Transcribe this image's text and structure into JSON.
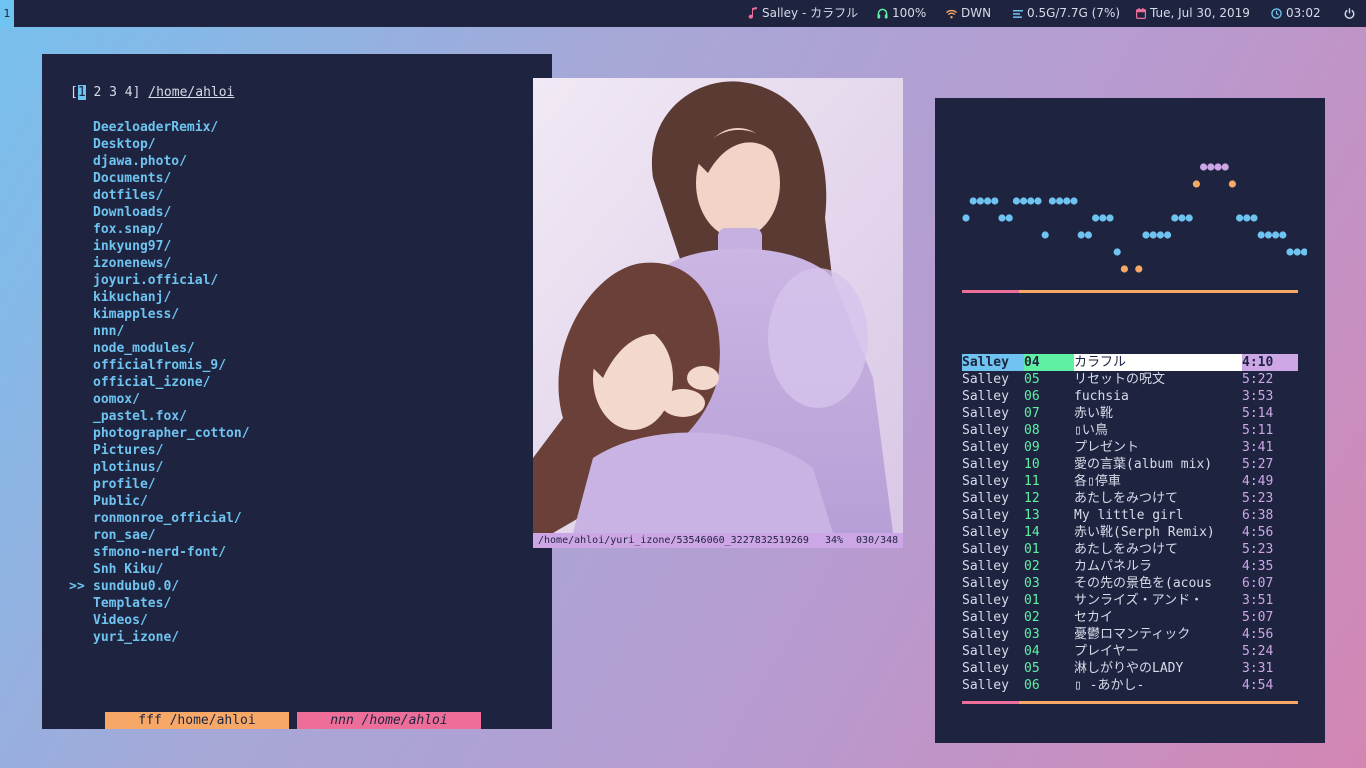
{
  "bar": {
    "workspace": "1",
    "now_playing": "Salley - カラフル",
    "volume": "100%",
    "network": "DWN",
    "memory": "0.5G/7.7G (7%)",
    "date": "Tue, Jul 30, 2019",
    "time": "03:02"
  },
  "file_manager": {
    "tab_open": "[",
    "tabs": [
      "1",
      "2",
      "3",
      "4"
    ],
    "tab_close": "]",
    "path": "/home/ahloi",
    "cursor_marker": ">>",
    "selected_index": 27,
    "dirs": [
      "DeezloaderRemix/",
      "Desktop/",
      "djawa.photo/",
      "Documents/",
      "dotfiles/",
      "Downloads/",
      "fox.snap/",
      "inkyung97/",
      "izonenews/",
      "joyuri.official/",
      "kikuchanj/",
      "kimappless/",
      "nnn/",
      "node_modules/",
      "officialfromis_9/",
      "official_izone/",
      "oomox/",
      "_pastel.fox/",
      "photographer_cotton/",
      "Pictures/",
      "plotinus/",
      "profile/",
      "Public/",
      "ronmonroe_official/",
      "ron_sae/",
      "sfmono-nerd-font/",
      "Snh Kiku/",
      "sundubu0.0/",
      "Templates/",
      "Videos/",
      "yuri_izone/"
    ],
    "tag_fff": "fff /home/ahloi",
    "tag_nnn": "nnn /home/ahloi"
  },
  "image_viewer": {
    "file_path": "/home/ahloi/yuri_izone/53546060_3227832519269",
    "zoom": "34%",
    "index": "030/348"
  },
  "player": {
    "progress_top": 0.17,
    "progress_bottom": 0.17,
    "current_index": 0,
    "tracks": [
      {
        "artist": "Salley",
        "num": "04",
        "title": "カラフル",
        "length": "4:10"
      },
      {
        "artist": "Salley",
        "num": "05",
        "title": "リセットの呪文",
        "length": "5:22"
      },
      {
        "artist": "Salley",
        "num": "06",
        "title": "fuchsia",
        "length": "3:53"
      },
      {
        "artist": "Salley",
        "num": "07",
        "title": "赤い靴",
        "length": "5:14"
      },
      {
        "artist": "Salley",
        "num": "08",
        "title": "▯い鳥",
        "length": "5:11"
      },
      {
        "artist": "Salley",
        "num": "09",
        "title": "プレゼント",
        "length": "3:41"
      },
      {
        "artist": "Salley",
        "num": "10",
        "title": "愛の言葉(album mix)",
        "length": "5:27"
      },
      {
        "artist": "Salley",
        "num": "11",
        "title": "各▯停車",
        "length": "4:49"
      },
      {
        "artist": "Salley",
        "num": "12",
        "title": "あたしをみつけて",
        "length": "5:23"
      },
      {
        "artist": "Salley",
        "num": "13",
        "title": "My little girl",
        "length": "6:38"
      },
      {
        "artist": "Salley",
        "num": "14",
        "title": "赤い靴(Serph Remix)",
        "length": "4:56"
      },
      {
        "artist": "Salley",
        "num": "01",
        "title": "あたしをみつけて",
        "length": "5:23"
      },
      {
        "artist": "Salley",
        "num": "02",
        "title": "カムパネルラ",
        "length": "4:35"
      },
      {
        "artist": "Salley",
        "num": "03",
        "title": "その先の景色を(acous",
        "length": "6:07"
      },
      {
        "artist": "Salley",
        "num": "01",
        "title": "サンライズ・アンド・",
        "length": "3:51"
      },
      {
        "artist": "Salley",
        "num": "02",
        "title": "セカイ",
        "length": "5:07"
      },
      {
        "artist": "Salley",
        "num": "03",
        "title": "憂鬱ロマンティック",
        "length": "4:56"
      },
      {
        "artist": "Salley",
        "num": "04",
        "title": "プレイヤー",
        "length": "5:24"
      },
      {
        "artist": "Salley",
        "num": "05",
        "title": "淋しがりやのLADY",
        "length": "3:31"
      },
      {
        "artist": "Salley",
        "num": "06",
        "title": "▯ -あかし-",
        "length": "4:54"
      }
    ]
  },
  "colors": {
    "panel_bg": "#1e2440",
    "blue": "#6fc3f0",
    "orange": "#f7a866",
    "pink": "#ee6e9a",
    "green": "#5ff0a4",
    "lavender": "#cda6e6",
    "fg": "#d6dbe8"
  },
  "icons": {
    "music": "music-note-icon",
    "volume": "headphones-icon",
    "network": "wifi-icon",
    "memory": "memory-list-icon",
    "date": "calendar-icon",
    "time": "clock-icon",
    "power": "power-icon"
  }
}
